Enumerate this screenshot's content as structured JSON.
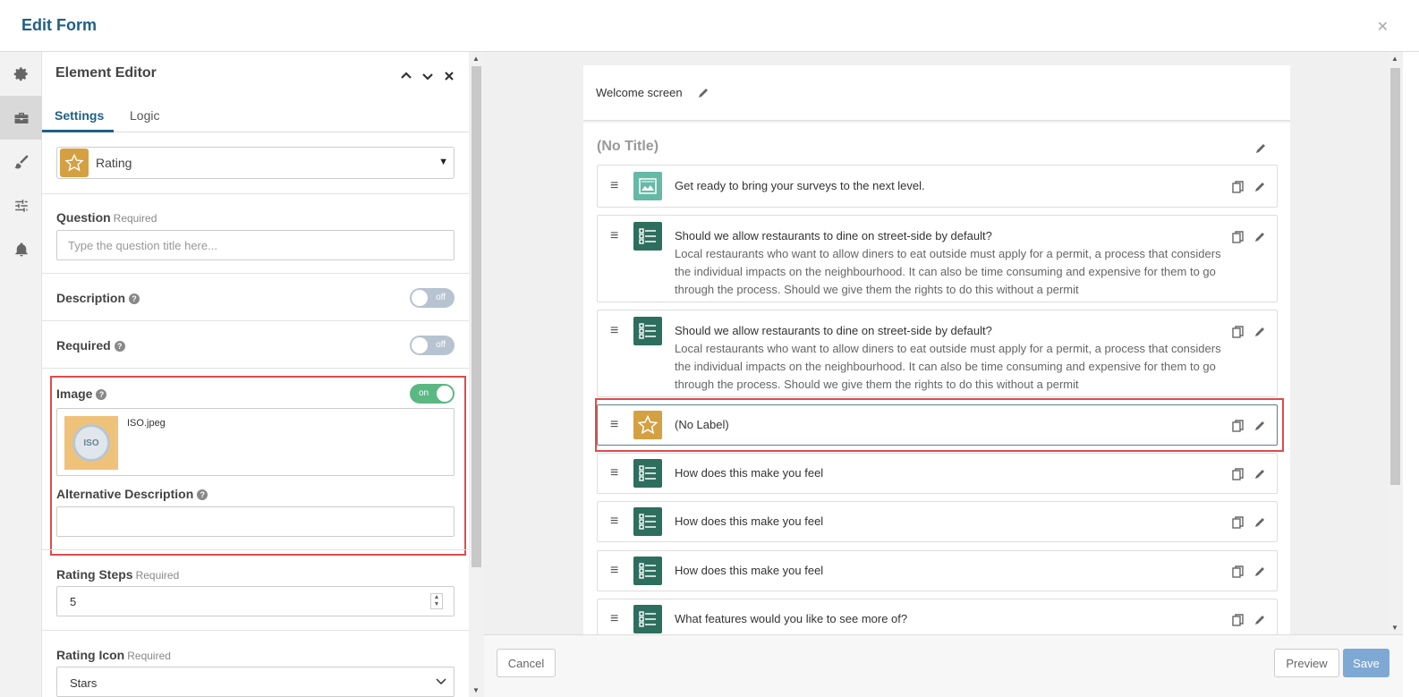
{
  "header": {
    "title": "Edit Form"
  },
  "rail": {
    "items": [
      "gear-icon",
      "briefcase-icon",
      "paintbrush-icon",
      "sliders-icon",
      "bell-icon"
    ],
    "active_index": 1
  },
  "editor": {
    "title": "Element Editor",
    "tabs": [
      {
        "label": "Settings",
        "active": true
      },
      {
        "label": "Logic",
        "active": false
      }
    ],
    "element_type": "Rating",
    "question": {
      "label": "Question",
      "required": "Required",
      "placeholder": "Type the question title here...",
      "value": ""
    },
    "description": {
      "label": "Description",
      "toggle": "off"
    },
    "required": {
      "label": "Required",
      "toggle": "off"
    },
    "image": {
      "label": "Image",
      "toggle": "on",
      "file_name": "ISO.jpeg",
      "thumb_text": "ISO"
    },
    "alt_description": {
      "label": "Alternative Description",
      "value": ""
    },
    "rating_steps": {
      "label": "Rating Steps",
      "required": "Required",
      "value": "5"
    },
    "rating_icon": {
      "label": "Rating Icon",
      "required": "Required",
      "value": "Stars"
    }
  },
  "canvas": {
    "welcome_label": "Welcome screen",
    "section_title": "(No Title)",
    "questions": [
      {
        "type": "image",
        "title": "Get ready to bring your surveys to the next level.",
        "description": ""
      },
      {
        "type": "list",
        "title": "Should we allow restaurants to dine on street-side by default?",
        "description": "Local restaurants who want to allow diners to eat outside must apply for a permit, a process that considers the individual impacts on the neighbourhood. It can also be time consuming and expensive for them to go through the process. Should we give them the rights to do this without a permit"
      },
      {
        "type": "list",
        "title": "Should we allow restaurants to dine on street-side by default?",
        "description": "Local restaurants who want to allow diners to eat outside must apply for a permit, a process that considers the individual impacts on the neighbourhood. It can also be time consuming and expensive for them to go through the process. Should we give them the rights to do this without a permit"
      },
      {
        "type": "rating",
        "title": "(No Label)",
        "description": "",
        "selected": true
      },
      {
        "type": "list",
        "title": "How does this make you feel",
        "description": ""
      },
      {
        "type": "list",
        "title": "How does this make you feel",
        "description": ""
      },
      {
        "type": "list",
        "title": "How does this make you feel",
        "description": ""
      },
      {
        "type": "list",
        "title": "What features would you like to see more of?",
        "description": ""
      }
    ]
  },
  "footer": {
    "cancel": "Cancel",
    "preview": "Preview",
    "save": "Save"
  },
  "colors": {
    "accent": "#1f5f85",
    "rating_icon_bg": "#d4a042",
    "list_icon_bg": "#2e6e5e",
    "image_icon_bg": "#66b9a6",
    "toggle_on": "#5ab883",
    "toggle_off": "#b7c3d0",
    "highlight": "#e04b4b",
    "save_button": "#7ea9d4"
  }
}
